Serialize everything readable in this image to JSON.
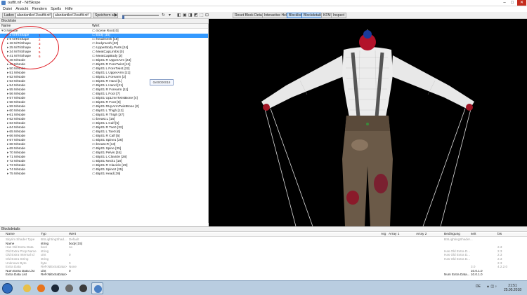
{
  "window": {
    "title": "outfit.nif - NifSkope",
    "min": "–",
    "max": "□",
    "close": "✕"
  },
  "menu": [
    "Datei",
    "Ansicht",
    "Rendern",
    "Spells",
    "Hilfe"
  ],
  "toolbar": {
    "load_label": "Laden",
    "load_path": "alandantler\\1\\outfit.nif",
    "save_path": "alandantler\\1\\outfit.nif",
    "save_label": "Speichern als",
    "reset_label": "Reset Block Details",
    "interactive_label": "Interactive Help",
    "blockliste_label": "Blockliste",
    "blockdetails_label": "Blockdetails",
    "kfm_label": "KFM",
    "inspect_label": "Inspect"
  },
  "blocklist": {
    "header": "Blockliste",
    "col_name": "Name",
    "col_value": "Wert",
    "tooltip": "0x00000018",
    "rows": [
      {
        "name": "0 NiNode",
        "value": "Scene Root [0]",
        "level": 0,
        "expanded": true,
        "selected": false,
        "num": ""
      },
      {
        "name": "2 NiTriShape",
        "value": "body [15]",
        "level": 1,
        "expanded": false,
        "selected": true,
        "num": "1"
      },
      {
        "name": "9 NiTriShape",
        "value": "headmesh [18]",
        "level": 1,
        "expanded": false,
        "selected": false,
        "num": "2"
      },
      {
        "name": "18 NiTriShape",
        "value": "bodymesh [20]",
        "level": 1,
        "expanded": false,
        "selected": false,
        "num": "3"
      },
      {
        "name": "25 NiTriShape",
        "value": "UpperBody.Parts [24]",
        "level": 1,
        "expanded": false,
        "selected": false,
        "num": "4"
      },
      {
        "name": "34 NiTriShape",
        "value": "MeatCapLimbs [0]",
        "level": 1,
        "expanded": false,
        "selected": false,
        "num": "5"
      },
      {
        "name": "41 NiTriShape",
        "value": "MeatCapBody [2]",
        "level": 1,
        "expanded": false,
        "selected": false,
        "num": "6"
      },
      {
        "name": "48 NiNode",
        "value": "Bip01 R UpperArm [23]",
        "level": 1,
        "expanded": false,
        "selected": false,
        "num": ""
      },
      {
        "name": "49 NiNode",
        "value": "Bip01 R ForeTwist [12]",
        "level": 1,
        "expanded": false,
        "selected": false,
        "num": ""
      },
      {
        "name": "50 NiNode",
        "value": "Bip01 L ForeTwist [22]",
        "level": 1,
        "expanded": false,
        "selected": false,
        "num": ""
      },
      {
        "name": "51 NiNode",
        "value": "Bip01 L UpperArm [21]",
        "level": 1,
        "expanded": false,
        "selected": false,
        "num": ""
      },
      {
        "name": "52 NiNode",
        "value": "Bip01 L Forearm [2]",
        "level": 1,
        "expanded": false,
        "selected": false,
        "num": ""
      },
      {
        "name": "53 NiNode",
        "value": "Bip01 R Hand [1]",
        "level": 1,
        "expanded": false,
        "selected": false,
        "num": ""
      },
      {
        "name": "54 NiNode",
        "value": "Bip01 L Hand [21]",
        "level": 1,
        "expanded": false,
        "selected": false,
        "num": ""
      },
      {
        "name": "55 NiNode",
        "value": "Bip01 R Forearm [11]",
        "level": 1,
        "expanded": false,
        "selected": false,
        "num": ""
      },
      {
        "name": "56 NiNode",
        "value": "Bip01 L Foot [7]",
        "level": 1,
        "expanded": false,
        "selected": false,
        "num": ""
      },
      {
        "name": "57 NiNode",
        "value": "Bip01 UpLimnTwistBone [4]",
        "level": 1,
        "expanded": false,
        "selected": false,
        "num": ""
      },
      {
        "name": "58 NiNode",
        "value": "Bip01 R Foot [8]",
        "level": 1,
        "expanded": false,
        "selected": false,
        "num": ""
      },
      {
        "name": "59 NiNode",
        "value": "Bip01 RUpArmTwistBone [2]",
        "level": 1,
        "expanded": false,
        "selected": false,
        "num": ""
      },
      {
        "name": "60 NiNode",
        "value": "Bip01 L Thigh [12]",
        "level": 1,
        "expanded": false,
        "selected": false,
        "num": ""
      },
      {
        "name": "61 NiNode",
        "value": "Bip01 R Thigh [27]",
        "level": 1,
        "expanded": false,
        "selected": false,
        "num": ""
      },
      {
        "name": "62 NiNode",
        "value": "breast.L [16]",
        "level": 1,
        "expanded": false,
        "selected": false,
        "num": ""
      },
      {
        "name": "63 NiNode",
        "value": "Bip01 L Calf [5]",
        "level": 1,
        "expanded": false,
        "selected": false,
        "num": ""
      },
      {
        "name": "64 NiNode",
        "value": "Bip01 R Toe0 [32]",
        "level": 1,
        "expanded": false,
        "selected": false,
        "num": ""
      },
      {
        "name": "65 NiNode",
        "value": "Bip01 L Toe0 [6]",
        "level": 1,
        "expanded": false,
        "selected": false,
        "num": ""
      },
      {
        "name": "66 NiNode",
        "value": "Bip01 R Calf [5]",
        "level": 1,
        "expanded": false,
        "selected": false,
        "num": ""
      },
      {
        "name": "67 NiNode",
        "value": "Bip01 Spine1 [26]",
        "level": 1,
        "expanded": false,
        "selected": false,
        "num": ""
      },
      {
        "name": "68 NiNode",
        "value": "breast.R [13]",
        "level": 1,
        "expanded": false,
        "selected": false,
        "num": ""
      },
      {
        "name": "69 NiNode",
        "value": "Bip01 Spine [35]",
        "level": 1,
        "expanded": false,
        "selected": false,
        "num": ""
      },
      {
        "name": "70 NiNode",
        "value": "Bip01 Pelvis [34]",
        "level": 1,
        "expanded": false,
        "selected": false,
        "num": ""
      },
      {
        "name": "71 NiNode",
        "value": "Bip01 L Clavicle [28]",
        "level": 1,
        "expanded": false,
        "selected": false,
        "num": ""
      },
      {
        "name": "72 NiNode",
        "value": "Bip01 Neck1 [18]",
        "level": 1,
        "expanded": false,
        "selected": false,
        "num": ""
      },
      {
        "name": "73 NiNode",
        "value": "Bip01 R Clavicle [29]",
        "level": 1,
        "expanded": false,
        "selected": false,
        "num": ""
      },
      {
        "name": "74 NiNode",
        "value": "Bip01 Spine2 [25]",
        "level": 1,
        "expanded": false,
        "selected": false,
        "num": ""
      },
      {
        "name": "75 NiNode",
        "value": "Bip01 Head [39]",
        "level": 1,
        "expanded": false,
        "selected": false,
        "num": ""
      }
    ]
  },
  "details": {
    "header": "Blockdetails",
    "columns": [
      "Name",
      "Typ",
      "Wert",
      "Arg",
      "Array 1",
      "Array 2",
      "Bedingung",
      "seit",
      "bis"
    ],
    "rows": [
      {
        "name": "Skyrim Shader Type",
        "type": "BSLightingShad...",
        "value": "Default",
        "cond": "BSLightingShader...",
        "since": "",
        "until": "",
        "dim": true
      },
      {
        "name": "Name",
        "type": "string",
        "value": "body [15]",
        "cond": "",
        "since": "",
        "until": "",
        "dim": false
      },
      {
        "name": "Has Old Extra Data",
        "type": "bool",
        "value": "no",
        "cond": "",
        "since": "",
        "until": "2.3",
        "dim": true
      },
      {
        "name": "Old Extra Prop Name",
        "type": "string",
        "value": "",
        "cond": "Has Old Extra D...",
        "since": "",
        "until": "2.3",
        "dim": true
      },
      {
        "name": "Old Extra Internal Id",
        "type": "uint",
        "value": "0",
        "cond": "Has Old Extra D...",
        "since": "",
        "until": "2.3",
        "dim": true
      },
      {
        "name": "Old Extra String",
        "type": "string",
        "value": "",
        "cond": "Has Old Extra D...",
        "since": "",
        "until": "2.3",
        "dim": true
      },
      {
        "name": "Unknown Byte",
        "type": "byte",
        "value": "0",
        "cond": "",
        "since": "",
        "until": "2.3",
        "dim": true
      },
      {
        "name": "Extra Data",
        "type": "Ref<NiExtraData>",
        "value": "None",
        "cond": "",
        "since": "3.0",
        "until": "4.2.2.0",
        "dim": true
      },
      {
        "name": "Num Extra Data List",
        "type": "uint",
        "value": "0",
        "cond": "",
        "since": "10.0.1.0",
        "until": "",
        "dim": false
      },
      {
        "name": "Extra Data List",
        "type": "Ref<NiExtraData>",
        "value": "",
        "cond": "Num Extra Data...",
        "since": "10.0.1.0",
        "until": "",
        "dim": false
      }
    ]
  },
  "taskbar": {
    "locale": "DE",
    "time": "21:51",
    "date": "25.05.2018"
  }
}
